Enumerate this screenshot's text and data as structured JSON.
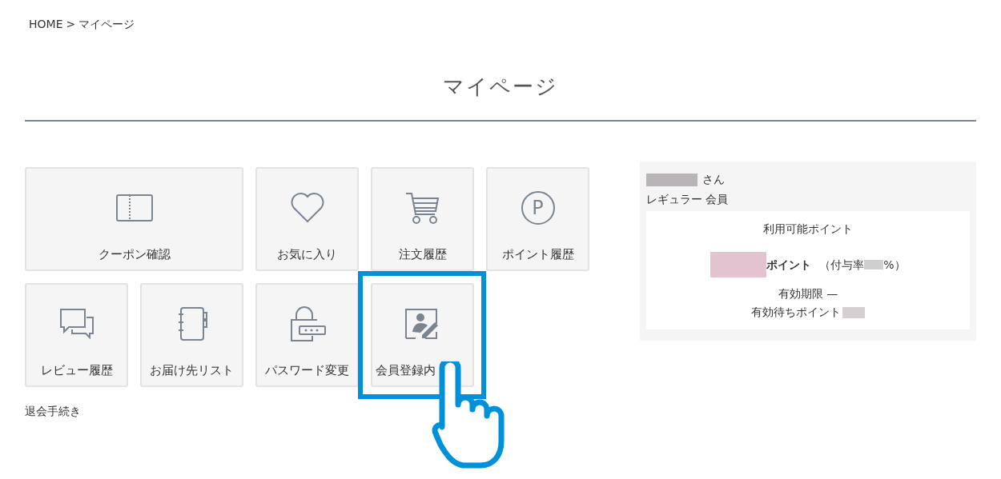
{
  "breadcrumb": [
    "HOME",
    ">",
    "マイページ"
  ],
  "page_title": "マイページ",
  "menu_tiles": [
    {
      "label": "クーポン確認",
      "wide": true
    },
    {
      "label": "お気に入り",
      "wide": false
    },
    {
      "label": "注文履歴",
      "wide": false
    },
    {
      "label": "ポイント履歴",
      "wide": false,
      "icon_text": "P"
    },
    {
      "label": "レビュー履歴",
      "wide": false
    },
    {
      "label": "お届け先リスト",
      "wide": false
    },
    {
      "label": "パスワード変更",
      "wide": false
    },
    {
      "label": "会員登録内",
      "wide": false,
      "highlighted": true
    }
  ],
  "withdraw_link": "退会手続き",
  "member": {
    "name_suffix": "さん",
    "rank": "レギュラー 会員",
    "points_title": "利用可能ポイント",
    "points_unit": "ポイント",
    "rate_prefix": "（付与率",
    "rate_suffix": "%）",
    "expiry": "有効期限 —",
    "pending": "有効待ちポイント"
  }
}
